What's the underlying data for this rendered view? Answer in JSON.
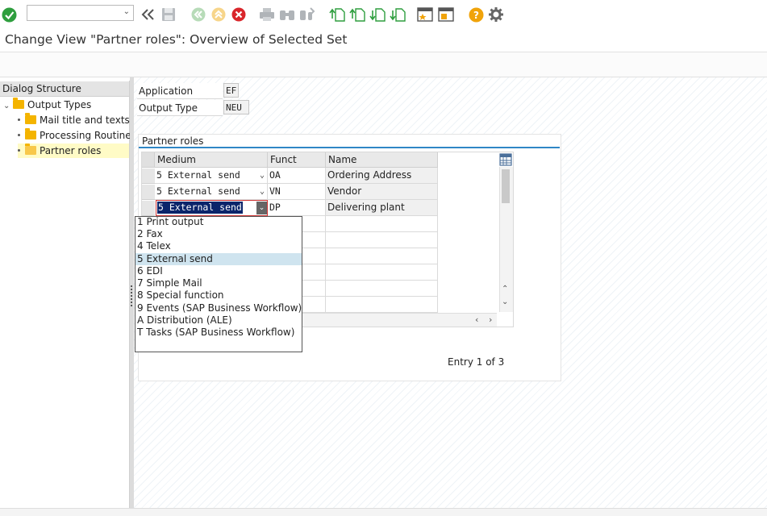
{
  "toolbar": {
    "command_field_value": "",
    "icons": [
      "enter-icon",
      "back-icon",
      "save-icon",
      "exit-icon",
      "up-icon",
      "cancel-icon",
      "print-icon",
      "find-icon",
      "find-next-icon",
      "first-page-icon",
      "prev-page-icon",
      "next-page-icon",
      "last-page-icon",
      "create-session-icon",
      "shortcut-icon",
      "help-icon",
      "settings-icon"
    ]
  },
  "title": "Change View \"Partner roles\": Overview of Selected Set",
  "dialog_structure": {
    "header": "Dialog Structure",
    "items": [
      {
        "label": "Output Types"
      },
      {
        "label": "Mail title and texts"
      },
      {
        "label": "Processing Routines"
      },
      {
        "label": "Partner roles"
      }
    ]
  },
  "fields": {
    "application_label": "Application",
    "application_value": "EF",
    "output_type_label": "Output Type",
    "output_type_value": "NEU"
  },
  "partner_roles": {
    "title": "Partner roles",
    "columns": [
      "Medium",
      "Funct",
      "Name"
    ],
    "rows": [
      {
        "medium": "5 External send",
        "funct": "OA",
        "name": "Ordering Address"
      },
      {
        "medium": "5 External send",
        "funct": "VN",
        "name": "Vendor"
      },
      {
        "medium": "5 External send",
        "funct": "DP",
        "name": "Delivering plant"
      }
    ],
    "entry_text": "Entry 1 of 3"
  },
  "medium_dropdown": {
    "options": [
      "1 Print output",
      "2 Fax",
      "4 Telex",
      "5 External send",
      "6 EDI",
      "7 Simple Mail",
      "8 Special function",
      "9 Events (SAP Business Workflow)",
      "A Distribution (ALE)",
      "T Tasks (SAP Business Workflow)"
    ],
    "selected": "5 External send"
  },
  "colors": {
    "accent_blue": "#2f86c6",
    "selection_navy": "#0a246a",
    "enter_green": "#2e9e3e",
    "cancel_red": "#d9262b",
    "help_orange": "#f0a30a"
  }
}
